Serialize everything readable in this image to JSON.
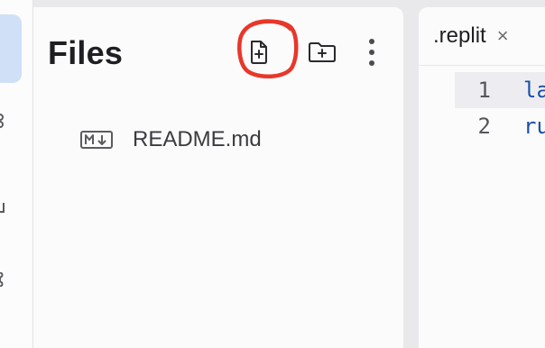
{
  "files_panel": {
    "title": "Files",
    "actions": {
      "new_file": "new-file-icon",
      "new_folder": "new-folder-icon",
      "more": "more-vertical-icon"
    },
    "items": [
      {
        "name": "README.md",
        "icon": "markdown-file-icon"
      }
    ]
  },
  "editor": {
    "tab": {
      "label": ".replit",
      "close": "×"
    },
    "lines": [
      {
        "num": "1",
        "code": "la"
      },
      {
        "num": "2",
        "code": "ru"
      }
    ]
  },
  "colors": {
    "annotation": "#e8372a",
    "rail_active": "#cfe0f7",
    "code": "#1a4fa8"
  }
}
